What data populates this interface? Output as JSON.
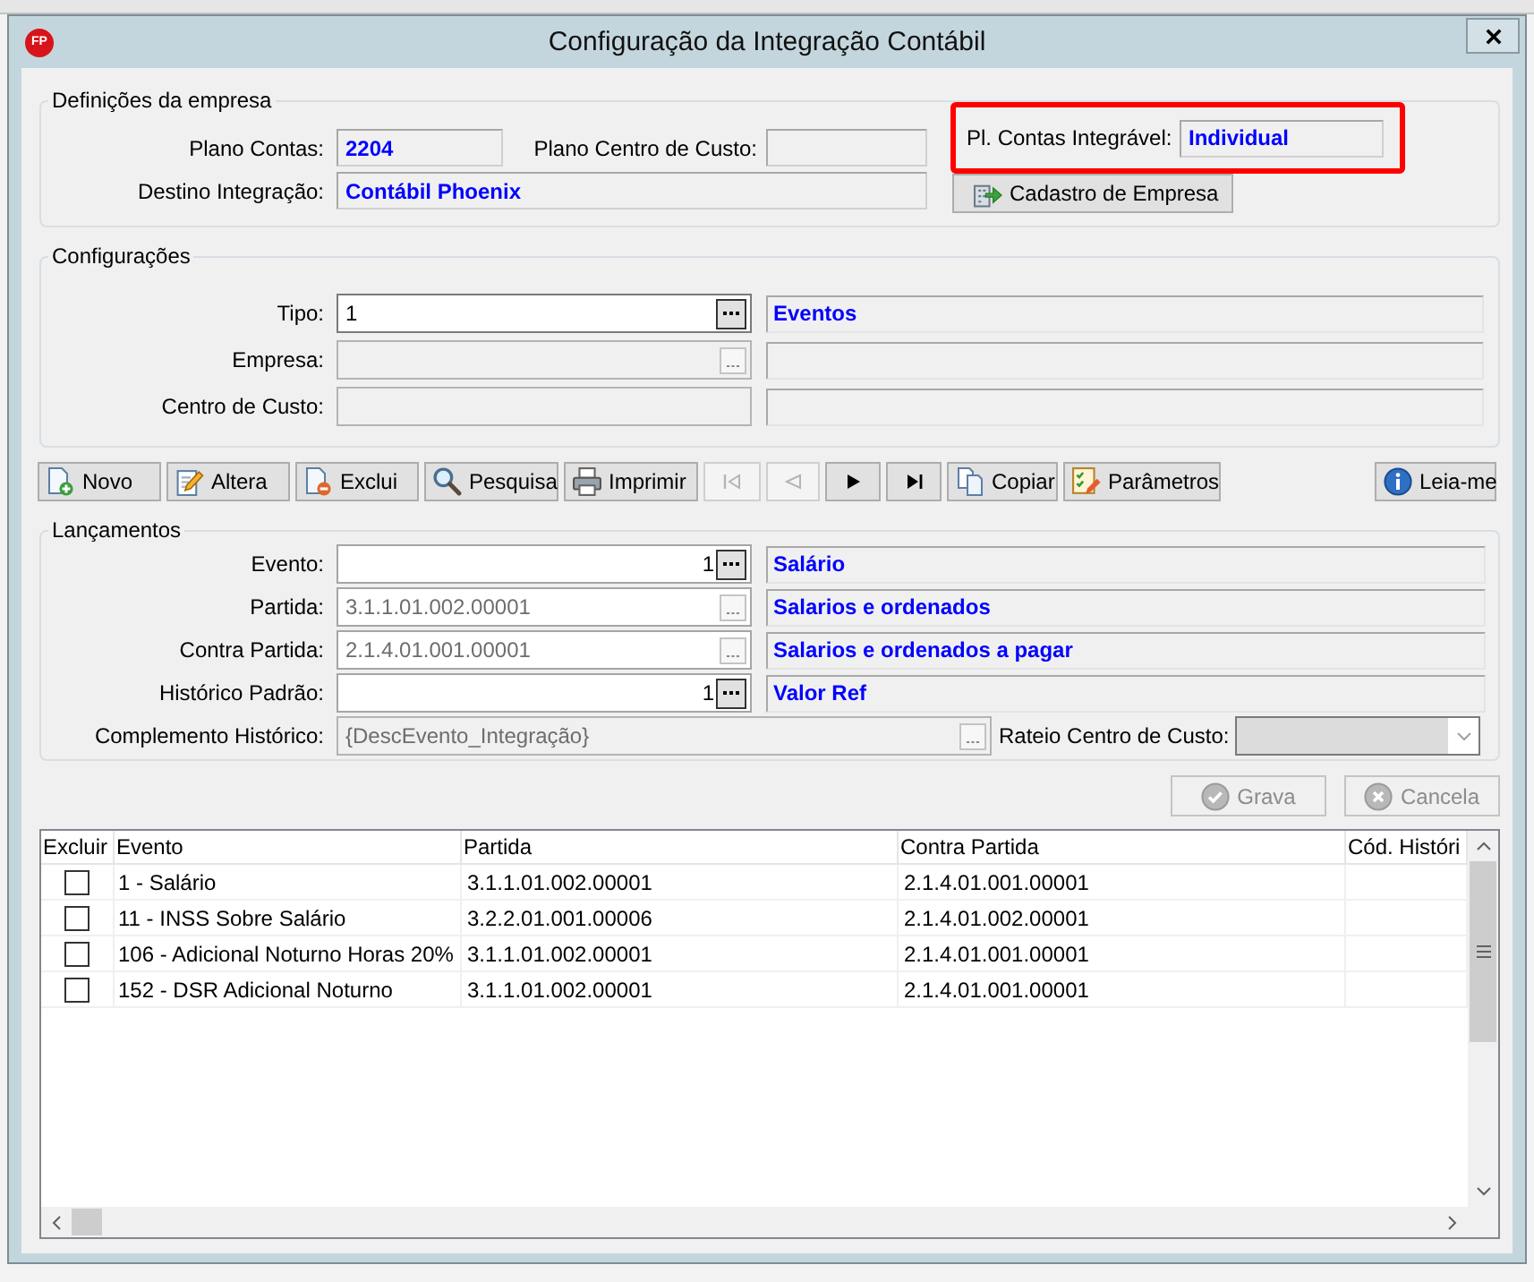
{
  "window": {
    "logo": "FP",
    "title": "Configuração da Integração Contábil"
  },
  "definicoes": {
    "legend": "Definições da empresa",
    "plano_contas": {
      "label": "Plano Contas:",
      "value": "2204"
    },
    "plano_centro_custo": {
      "label": "Plano Centro de Custo:"
    },
    "destino_integracao": {
      "label": "Destino Integração:",
      "value": "Contábil Phoenix"
    },
    "pl_contas_integravel": {
      "label": "Pl. Contas Integrável:",
      "value": "Individual",
      "highlighted": true
    },
    "cadastro_button": {
      "label": "Cadastro de Empresa"
    }
  },
  "configuracoes": {
    "legend": "Configurações",
    "rows": [
      {
        "label": "Tipo:",
        "value": "1",
        "disabled": false,
        "lookup": true,
        "description": "Eventos"
      },
      {
        "label": "Empresa:",
        "disabled": true,
        "lookup": true
      },
      {
        "label": "Centro de Custo:",
        "disabled": true,
        "lookup": false
      }
    ]
  },
  "toolbar": {
    "buttons": [
      {
        "kind": "text",
        "label": "Novo"
      },
      {
        "kind": "text",
        "label": "Altera"
      },
      {
        "kind": "text",
        "label": "Exclui"
      },
      {
        "kind": "text",
        "label": "Pesquisa"
      },
      {
        "kind": "text",
        "label": "Imprimir"
      },
      {
        "kind": "nav",
        "disabled": true
      },
      {
        "kind": "nav",
        "disabled": true
      },
      {
        "kind": "nav",
        "disabled": false
      },
      {
        "kind": "nav",
        "disabled": false
      },
      {
        "kind": "text",
        "label": "Copiar"
      },
      {
        "kind": "text",
        "label": "Parâmetros"
      }
    ],
    "help": {
      "label": "Leia-me"
    }
  },
  "lancamentos": {
    "legend": "Lançamentos",
    "rows": [
      {
        "kind": "code",
        "label": "Evento:",
        "value": "1",
        "description": "Salário"
      },
      {
        "kind": "account",
        "label": "Partida:",
        "value": "3.1.1.01.002.00001",
        "description": "Salarios e ordenados"
      },
      {
        "kind": "account",
        "label": "Contra Partida:",
        "value": "2.1.4.01.001.00001",
        "description": "Salarios e ordenados a pagar"
      },
      {
        "kind": "code",
        "label": "Histórico Padrão:",
        "value": "1",
        "description": "Valor Ref"
      }
    ],
    "complemento": {
      "label": "Complemento Histórico:",
      "value": "{DescEvento_Integração}"
    },
    "rateio": {
      "label": "Rateio Centro de Custo:",
      "disabled": true
    }
  },
  "actions": [
    {
      "label": "Grava",
      "disabled": true
    },
    {
      "label": "Cancela",
      "disabled": true
    }
  ],
  "table": {
    "columns": [
      "Excluir",
      "Evento",
      "Partida",
      "Contra Partida",
      "Cód. Históri"
    ],
    "rows": [
      {
        "checked": false,
        "evento": "1 - Salário",
        "partida": "3.1.1.01.002.00001",
        "contra_partida": "2.1.4.01.001.00001"
      },
      {
        "checked": false,
        "evento": "11 - INSS Sobre Salário",
        "partida": "3.2.2.01.001.00006",
        "contra_partida": "2.1.4.01.002.00001"
      },
      {
        "checked": false,
        "evento": "106 - Adicional Noturno Horas 20%",
        "partida": "3.1.1.01.002.00001",
        "contra_partida": "2.1.4.01.001.00001"
      },
      {
        "checked": false,
        "evento": "152 - DSR Adicional Noturno",
        "partida": "3.1.1.01.002.00001",
        "contra_partida": "2.1.4.01.001.00001"
      }
    ]
  }
}
